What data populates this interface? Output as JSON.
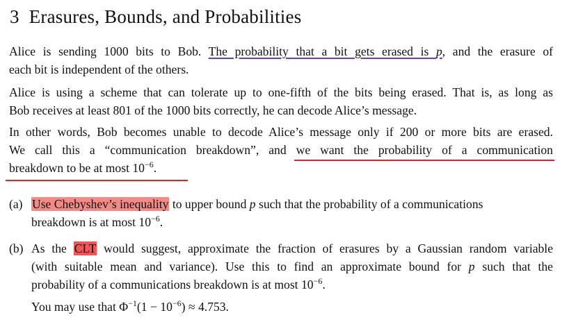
{
  "section": {
    "number": "3",
    "title": "Erasures, Bounds, and Probabilities"
  },
  "p1": {
    "a": "Alice is sending 1000 bits to Bob.",
    "underlined": "The probability that a bit gets erased is",
    "var_p": "p",
    "b": ", and the erasure of",
    "c": "each bit is independent of the others."
  },
  "p2": {
    "l1": "Alice is using a scheme that can tolerate up to one-fifth of the bits being erased. That is, as long as",
    "l2": "Bob receives at least 801 of the 1000 bits correctly, he can decode Alice’s message."
  },
  "p3": {
    "l1": "In other words, Bob becomes unable to decode Alice’s message only if 200 or more bits are erased.",
    "l2a": "We call this a “communication breakdown”, and",
    "l2b": "we want the probability of a communication",
    "l3a": "breakdown to be at most 10",
    "l3sup": "−6",
    "l3b": "."
  },
  "a": {
    "label": "(a)",
    "highlight": "Use Chebyshev’s inequality",
    "t1": "to upper bound",
    "var_p": "p",
    "t2": "such that the probability of a communications",
    "t3": "breakdown is at most 10",
    "sup": "−6",
    "t4": "."
  },
  "b": {
    "label": "(b)",
    "t0": "As the",
    "highlight": "CLT",
    "t1": "would suggest, approximate the fraction of erasures by a Gaussian random variable",
    "t2": "(with suitable mean and variance). Use this to find an approximate bound for",
    "var_p": "p",
    "t3": "such that the",
    "t4": "probability of a communications breakdown is at most 10",
    "sup": "−6",
    "t5": ".",
    "hint_a": "You may use that Φ",
    "hint_sup1": "−1",
    "hint_b": "(1 − 10",
    "hint_sup2": "−6",
    "hint_c": ") ≈ 4.753."
  },
  "colors": {
    "purple_underline": "#6a3fb5",
    "red_underline": "#d7262a",
    "pink_highlight": "#f28b86",
    "red_highlight": "#f15555"
  }
}
